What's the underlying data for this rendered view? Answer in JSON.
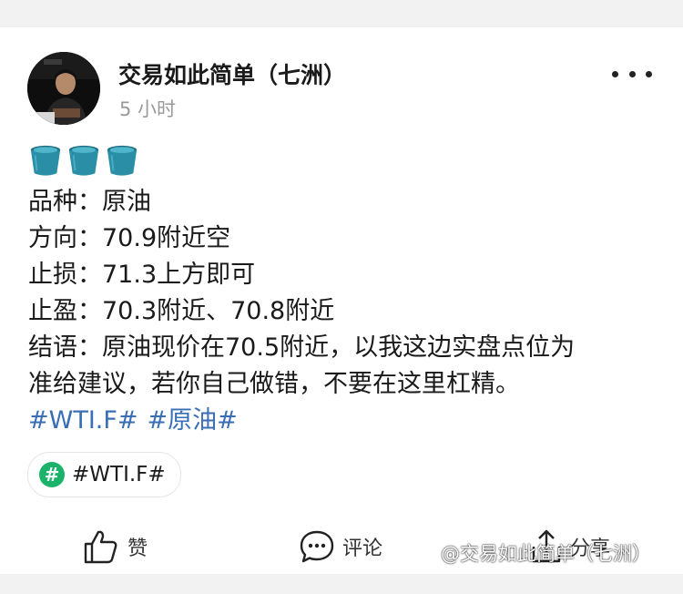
{
  "post": {
    "author_name": "交易如此简单（七洲）",
    "time": "5 小时",
    "emoji": [
      "bucket-icon",
      "bucket-icon",
      "bucket-icon"
    ],
    "lines": [
      "品种：原油",
      "方向：70.9附近空",
      "止损：71.3上方即可",
      "止盈：70.3附近、70.8附近",
      "结语：原油现价在70.5附近，以我这边实盘点位为",
      "准给建议，若你自己做错，不要在这里杠精。"
    ],
    "hashtags": [
      "#WTI.F#",
      "#原油#"
    ],
    "topic_chip": "#WTI.F#"
  },
  "actions": {
    "like_label": "赞",
    "comment_label": "评论",
    "share_label": "分享"
  },
  "watermark": "@交易如此简单（七洲）",
  "colors": {
    "hashtag": "#3a6fb5",
    "topic_green": "#1bb36a",
    "bucket": "#2a8fa6"
  }
}
